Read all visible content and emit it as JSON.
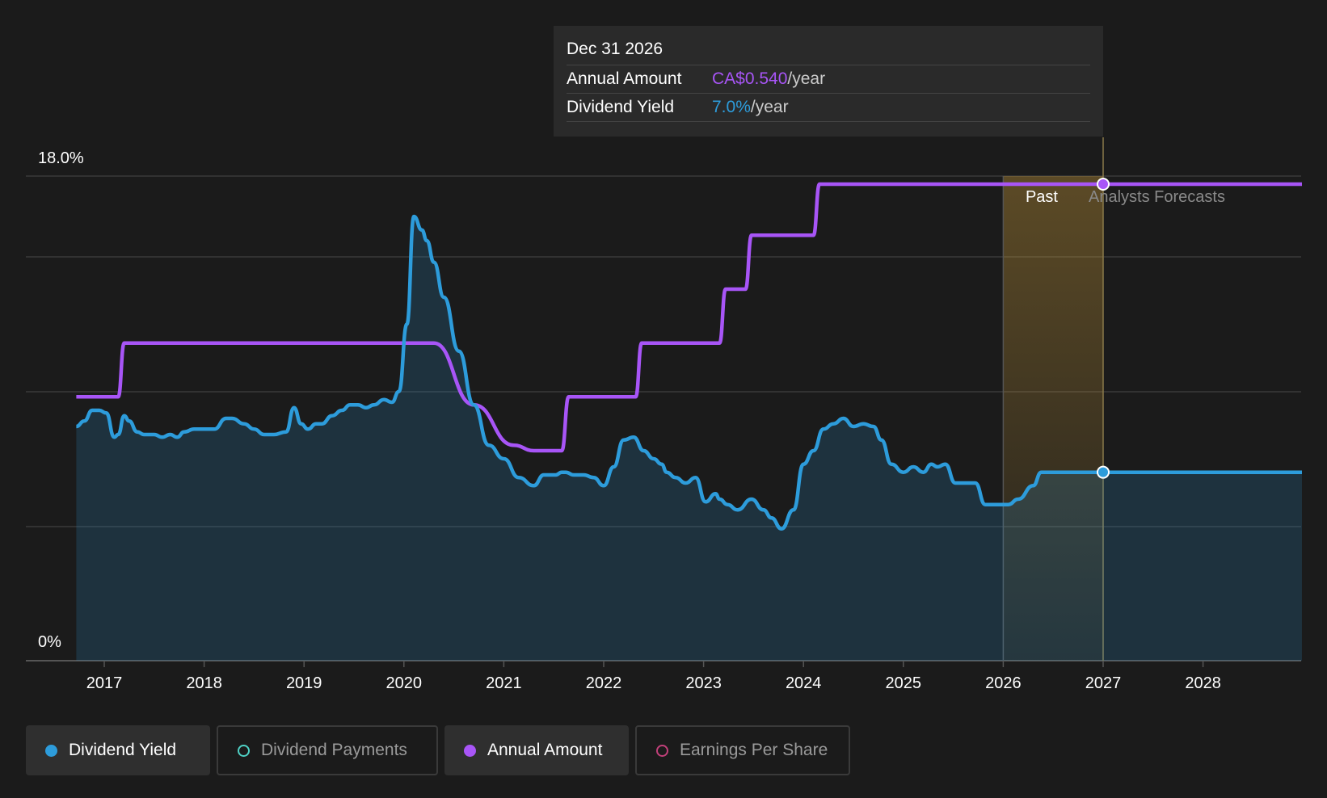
{
  "chart_data": {
    "type": "line",
    "y_axis": {
      "ylim": [
        0,
        18
      ],
      "top_label": "18.0%",
      "bottom_label": "0%"
    },
    "x_axis": {
      "xlim": [
        2016.7,
        2029.0
      ],
      "ticks": [
        "2017",
        "2018",
        "2019",
        "2020",
        "2021",
        "2022",
        "2023",
        "2024",
        "2025",
        "2026",
        "2027",
        "2028"
      ]
    },
    "past_label": "Past",
    "forecast_label": "Analysts Forecasts",
    "forecast_band": [
      2026.0,
      2027.0
    ],
    "tooltip": {
      "date": "Dec 31 2026",
      "rows": [
        {
          "label": "Annual Amount",
          "value": "CA$0.540",
          "unit": "/year",
          "color": "purple"
        },
        {
          "label": "Dividend Yield",
          "value": "7.0%",
          "unit": "/year",
          "color": "blue"
        }
      ]
    },
    "series": [
      {
        "name": "Dividend Yield",
        "color": "#2d9cdb",
        "x": [
          2016.72,
          2016.8,
          2016.88,
          2016.95,
          2017.02,
          2017.1,
          2017.14,
          2017.2,
          2017.25,
          2017.33,
          2017.4,
          2017.5,
          2017.58,
          2017.66,
          2017.73,
          2017.8,
          2017.9,
          2018.0,
          2018.1,
          2018.22,
          2018.28,
          2018.4,
          2018.5,
          2018.6,
          2018.7,
          2018.82,
          2018.9,
          2018.97,
          2019.04,
          2019.12,
          2019.18,
          2019.28,
          2019.38,
          2019.46,
          2019.54,
          2019.62,
          2019.7,
          2019.8,
          2019.88,
          2019.95,
          2020.03,
          2020.1,
          2020.18,
          2020.23,
          2020.3,
          2020.4,
          2020.55,
          2020.7,
          2020.85,
          2021.0,
          2021.15,
          2021.3,
          2021.4,
          2021.52,
          2021.58,
          2021.62,
          2021.7,
          2021.8,
          2021.9,
          2022.0,
          2022.1,
          2022.2,
          2022.3,
          2022.4,
          2022.5,
          2022.58,
          2022.63,
          2022.72,
          2022.82,
          2022.92,
          2023.02,
          2023.12,
          2023.16,
          2023.24,
          2023.34,
          2023.48,
          2023.6,
          2023.68,
          2023.78,
          2023.9,
          2024.0,
          2024.1,
          2024.2,
          2024.3,
          2024.4,
          2024.5,
          2024.6,
          2024.7,
          2024.78,
          2024.88,
          2025.0,
          2025.1,
          2025.2,
          2025.28,
          2025.34,
          2025.42,
          2025.52,
          2025.62,
          2025.72,
          2025.82,
          2025.9,
          2025.96,
          2026.05,
          2026.15,
          2026.3,
          2026.38,
          2026.45,
          2026.55,
          2026.7,
          2026.8,
          2027.0,
          2028.99
        ],
        "values": [
          8.7,
          8.9,
          9.3,
          9.3,
          9.2,
          8.3,
          8.4,
          9.1,
          8.9,
          8.5,
          8.4,
          8.4,
          8.3,
          8.4,
          8.3,
          8.5,
          8.6,
          8.6,
          8.6,
          9.0,
          9.0,
          8.8,
          8.6,
          8.4,
          8.4,
          8.5,
          9.4,
          8.8,
          8.6,
          8.8,
          8.8,
          9.1,
          9.3,
          9.5,
          9.5,
          9.4,
          9.5,
          9.7,
          9.6,
          10.0,
          12.5,
          16.5,
          16.0,
          15.6,
          14.8,
          13.5,
          11.5,
          9.5,
          8.0,
          7.5,
          6.8,
          6.5,
          6.9,
          6.9,
          7.0,
          7.0,
          6.9,
          6.9,
          6.8,
          6.5,
          7.2,
          8.2,
          8.3,
          7.8,
          7.5,
          7.3,
          7.0,
          6.8,
          6.6,
          6.8,
          5.9,
          6.2,
          6.0,
          5.8,
          5.6,
          6.0,
          5.6,
          5.3,
          4.9,
          5.6,
          7.3,
          7.8,
          8.6,
          8.8,
          9.0,
          8.7,
          8.8,
          8.7,
          8.2,
          7.3,
          7.0,
          7.2,
          7.0,
          7.3,
          7.2,
          7.3,
          6.6,
          6.6,
          6.6,
          5.8,
          5.8,
          5.8,
          5.8,
          6.0,
          6.5,
          7.0,
          7.0,
          7.0,
          7.0,
          7.0,
          7.0,
          7.0
        ]
      },
      {
        "name": "Annual Amount",
        "color": "#a855f7",
        "step_x": [
          2016.72,
          2017.14,
          2017.2,
          2020.18,
          2020.3,
          2020.7,
          2021.1,
          2021.3,
          2021.58,
          2021.65,
          2022.32,
          2022.38,
          2023.16,
          2023.22,
          2023.42,
          2023.48,
          2024.1,
          2024.16,
          2028.99
        ],
        "step_values": [
          9.8,
          9.8,
          11.8,
          11.8,
          11.8,
          9.5,
          8.0,
          7.8,
          7.8,
          9.8,
          9.8,
          11.8,
          11.8,
          13.8,
          13.8,
          15.8,
          15.8,
          17.7,
          17.7
        ]
      }
    ]
  },
  "legend": [
    {
      "label": "Dividend Yield",
      "color": "#2d9cdb",
      "active": true,
      "x": 32,
      "w": 228
    },
    {
      "label": "Dividend Payments",
      "color": "#4fd1c5",
      "active": false,
      "x": 268,
      "w": 274
    },
    {
      "label": "Annual Amount",
      "color": "#a855f7",
      "active": true,
      "x": 550,
      "w": 228
    },
    {
      "label": "Earnings Per Share",
      "color": "#c2407a",
      "active": false,
      "x": 786,
      "w": 266
    }
  ]
}
